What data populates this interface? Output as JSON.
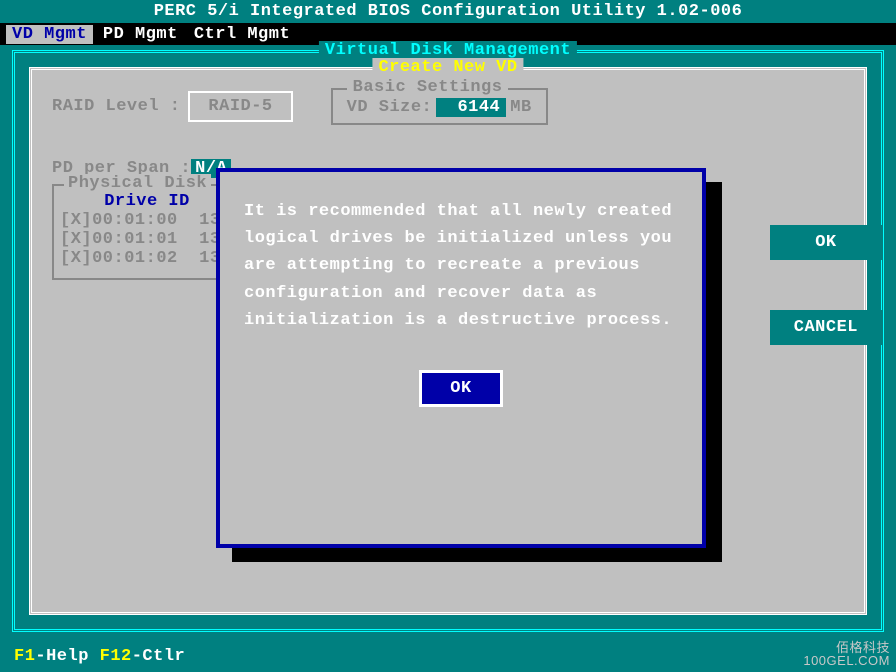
{
  "title": "PERC 5/i Integrated BIOS Configuration Utility 1.02-006",
  "menu": {
    "vd": "VD Mgmt",
    "pd": "PD Mgmt",
    "ctrl": "Ctrl Mgmt"
  },
  "outer": {
    "title": "Virtual Disk Management"
  },
  "create": {
    "title": "Create New VD",
    "raid_label": "RAID Level :",
    "raid_value": "RAID-5",
    "basic_title": "Basic Settings",
    "vd_size_label": "VD Size:",
    "vd_size_value": "6144",
    "vd_size_unit": "MB",
    "pd_span_label": "PD per Span :",
    "pd_span_value": "N/A",
    "phys_title": "Physical Disk",
    "drive_header": "Drive ID",
    "drives": [
      {
        "row": "[X]00:01:00  13"
      },
      {
        "row": "[X]00:01:01  13"
      },
      {
        "row": "[X]00:01:02  13"
      }
    ],
    "ok": "OK",
    "cancel": "CANCEL"
  },
  "modal": {
    "text": "It is recommended that all newly created logical drives be initialized unless you are attempting to recreate a previous configuration and recover data as initialization is a destructive process.",
    "ok": "OK"
  },
  "footer": {
    "f1k": "F1",
    "f1t": "-Help ",
    "f12k": "F12",
    "f12t": "-Ctlr"
  },
  "watermark": {
    "l1": "佰格科技",
    "l2": "100GEL.COM"
  }
}
